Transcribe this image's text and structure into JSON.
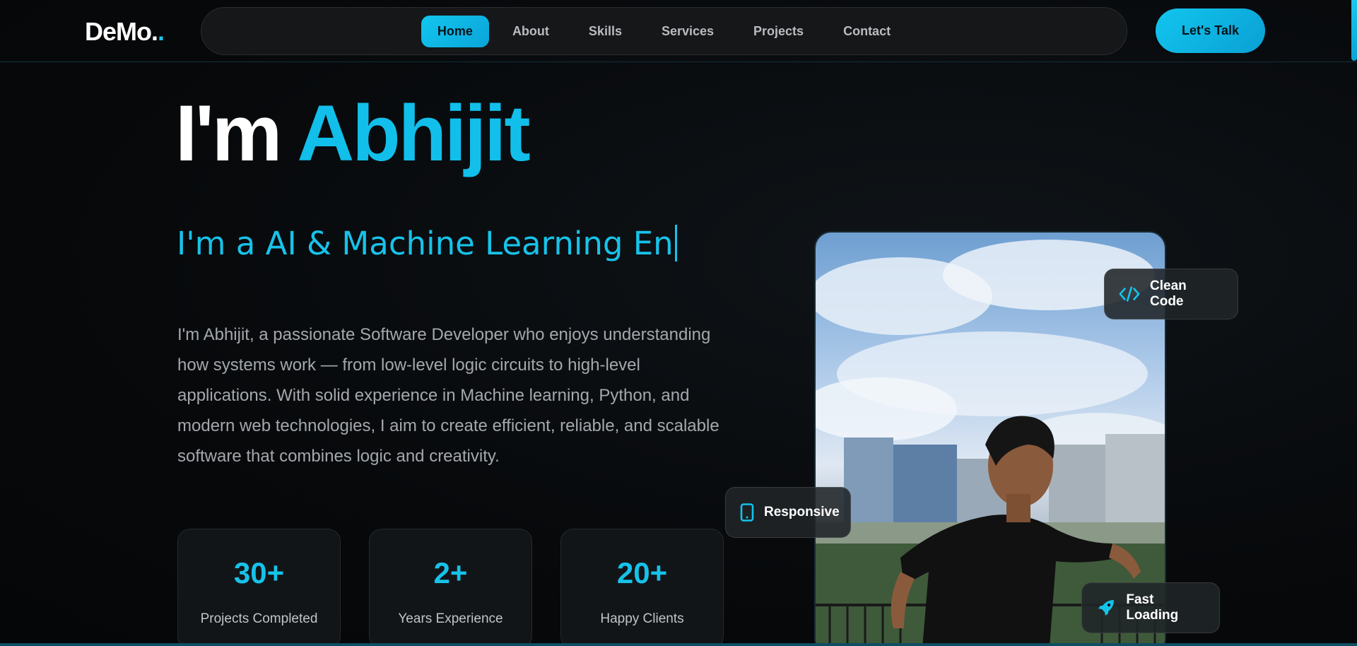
{
  "header": {
    "logo_text": "DeMo.",
    "logo_dot": ".",
    "cta_label": "Let's Talk"
  },
  "nav": {
    "items": [
      {
        "label": "Home",
        "active": true
      },
      {
        "label": "About",
        "active": false
      },
      {
        "label": "Skills",
        "active": false
      },
      {
        "label": "Services",
        "active": false
      },
      {
        "label": "Projects",
        "active": false
      },
      {
        "label": "Contact",
        "active": false
      }
    ]
  },
  "hero": {
    "greeting": "I'm",
    "name": "Abhijit",
    "typed_text": "I'm a AI & Machine Learning En",
    "bio": "I'm Abhijit, a passionate Software Developer who enjoys understanding how systems work — from low-level logic circuits to high-level applications. With solid experience in Machine learning, Python, and modern web technologies, I aim to create efficient, reliable, and scalable software that combines logic and creativity."
  },
  "stats": [
    {
      "value": "30+",
      "label": "Projects Completed"
    },
    {
      "value": "2+",
      "label": "Years Experience"
    },
    {
      "value": "20+",
      "label": "Happy Clients"
    }
  ],
  "badges": {
    "clean_code": {
      "label": "Clean Code",
      "icon": "code-icon"
    },
    "responsive": {
      "label": "Responsive",
      "icon": "mobile-icon"
    },
    "fast_loading": {
      "label": "Fast Loading",
      "icon": "rocket-icon"
    }
  },
  "colors": {
    "accent": "#12c6ee",
    "background": "#07090b"
  }
}
